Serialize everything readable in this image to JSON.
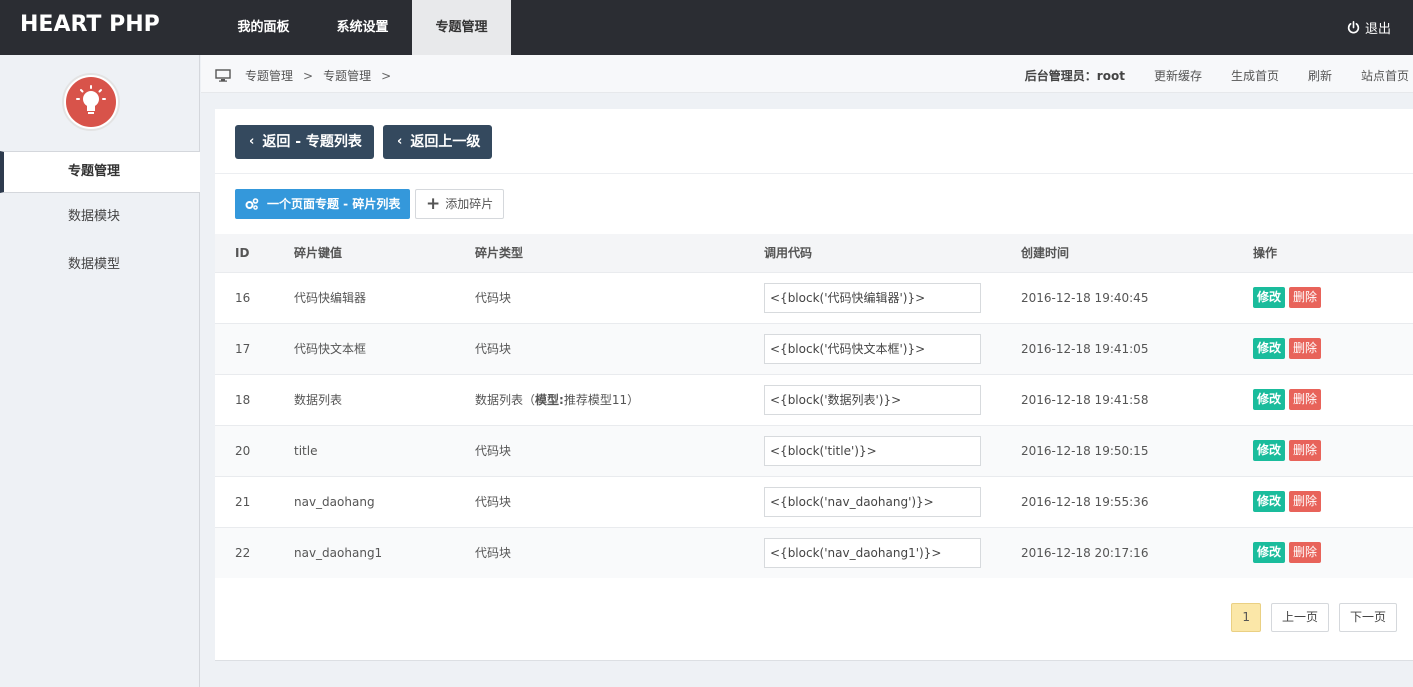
{
  "header": {
    "logo": "HEART PHP",
    "nav": [
      "我的面板",
      "系统设置",
      "专题管理"
    ],
    "logout": "退出"
  },
  "sidebar": {
    "items": [
      {
        "label": "专题管理",
        "active": true
      },
      {
        "label": "数据模块",
        "active": false
      },
      {
        "label": "数据模型",
        "active": false
      }
    ]
  },
  "breadcrumb": {
    "items": [
      "专题管理",
      "专题管理"
    ],
    "separator": ">",
    "admin": "后台管理员：root",
    "links": [
      "更新缓存",
      "生成首页",
      "刷新",
      "站点首页"
    ]
  },
  "actions": {
    "back_list": "返回 - 专题列表",
    "back_up": "返回上一级",
    "fragment_list": "一个页面专题 - 碎片列表",
    "add_fragment": "添加碎片"
  },
  "table": {
    "headers": [
      "ID",
      "碎片键值",
      "碎片类型",
      "调用代码",
      "创建时间",
      "操作"
    ],
    "rows": [
      {
        "id": "16",
        "key": "代码快编辑器",
        "type": "代码块",
        "type_extra": "",
        "code": "<{block('代码快编辑器')}>",
        "time": "2016-12-18 19:40:45"
      },
      {
        "id": "17",
        "key": "代码快文本框",
        "type": "代码块",
        "type_extra": "",
        "code": "<{block('代码快文本框')}>",
        "time": "2016-12-18 19:41:05"
      },
      {
        "id": "18",
        "key": "数据列表",
        "type": "数据列表（",
        "type_bold": "模型:",
        "type_extra": "推荐模型11）",
        "code": "<{block('数据列表')}>",
        "time": "2016-12-18 19:41:58"
      },
      {
        "id": "20",
        "key": "title",
        "type": "代码块",
        "type_extra": "",
        "code": "<{block('title')}>",
        "time": "2016-12-18 19:50:15"
      },
      {
        "id": "21",
        "key": "nav_daohang",
        "type": "代码块",
        "type_extra": "",
        "code": "<{block('nav_daohang')}>",
        "time": "2016-12-18 19:55:36"
      },
      {
        "id": "22",
        "key": "nav_daohang1",
        "type": "代码块",
        "type_extra": "",
        "code": "<{block('nav_daohang1')}>",
        "time": "2016-12-18 20:17:16"
      }
    ],
    "edit_label": "修改",
    "delete_label": "删除"
  },
  "pagination": {
    "current": "1",
    "prev": "上一页",
    "next": "下一页"
  },
  "colors": {
    "topbar": "#2b2d33",
    "dark_button": "#34495e",
    "blue_button": "#3498db",
    "edit_button": "#1abc9c",
    "delete_button": "#e8635a",
    "avatar": "#d8534a"
  },
  "icons": [
    "power-icon",
    "monitor-icon",
    "chevron-left-icon",
    "cogs-icon",
    "plus-icon",
    "lightbulb-icon"
  ]
}
